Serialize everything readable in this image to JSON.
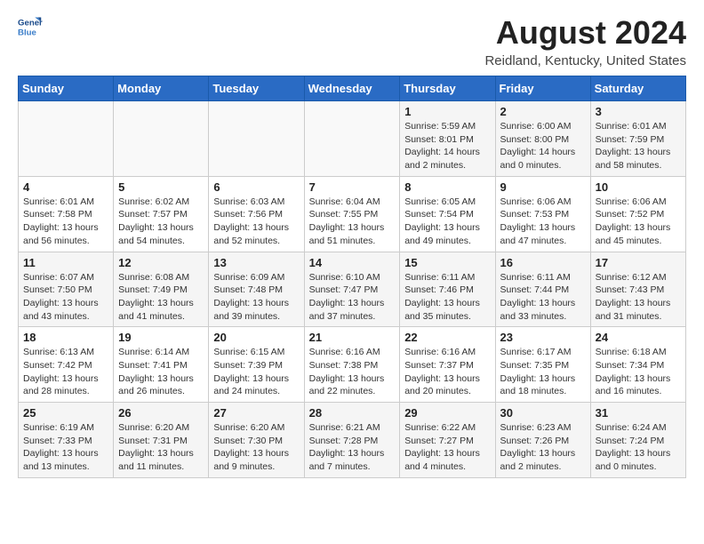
{
  "header": {
    "logo_line1": "General",
    "logo_line2": "Blue",
    "month_year": "August 2024",
    "location": "Reidland, Kentucky, United States"
  },
  "weekdays": [
    "Sunday",
    "Monday",
    "Tuesday",
    "Wednesday",
    "Thursday",
    "Friday",
    "Saturday"
  ],
  "weeks": [
    [
      {
        "day": "",
        "content": ""
      },
      {
        "day": "",
        "content": ""
      },
      {
        "day": "",
        "content": ""
      },
      {
        "day": "",
        "content": ""
      },
      {
        "day": "1",
        "content": "Sunrise: 5:59 AM\nSunset: 8:01 PM\nDaylight: 14 hours\nand 2 minutes."
      },
      {
        "day": "2",
        "content": "Sunrise: 6:00 AM\nSunset: 8:00 PM\nDaylight: 14 hours\nand 0 minutes."
      },
      {
        "day": "3",
        "content": "Sunrise: 6:01 AM\nSunset: 7:59 PM\nDaylight: 13 hours\nand 58 minutes."
      }
    ],
    [
      {
        "day": "4",
        "content": "Sunrise: 6:01 AM\nSunset: 7:58 PM\nDaylight: 13 hours\nand 56 minutes."
      },
      {
        "day": "5",
        "content": "Sunrise: 6:02 AM\nSunset: 7:57 PM\nDaylight: 13 hours\nand 54 minutes."
      },
      {
        "day": "6",
        "content": "Sunrise: 6:03 AM\nSunset: 7:56 PM\nDaylight: 13 hours\nand 52 minutes."
      },
      {
        "day": "7",
        "content": "Sunrise: 6:04 AM\nSunset: 7:55 PM\nDaylight: 13 hours\nand 51 minutes."
      },
      {
        "day": "8",
        "content": "Sunrise: 6:05 AM\nSunset: 7:54 PM\nDaylight: 13 hours\nand 49 minutes."
      },
      {
        "day": "9",
        "content": "Sunrise: 6:06 AM\nSunset: 7:53 PM\nDaylight: 13 hours\nand 47 minutes."
      },
      {
        "day": "10",
        "content": "Sunrise: 6:06 AM\nSunset: 7:52 PM\nDaylight: 13 hours\nand 45 minutes."
      }
    ],
    [
      {
        "day": "11",
        "content": "Sunrise: 6:07 AM\nSunset: 7:50 PM\nDaylight: 13 hours\nand 43 minutes."
      },
      {
        "day": "12",
        "content": "Sunrise: 6:08 AM\nSunset: 7:49 PM\nDaylight: 13 hours\nand 41 minutes."
      },
      {
        "day": "13",
        "content": "Sunrise: 6:09 AM\nSunset: 7:48 PM\nDaylight: 13 hours\nand 39 minutes."
      },
      {
        "day": "14",
        "content": "Sunrise: 6:10 AM\nSunset: 7:47 PM\nDaylight: 13 hours\nand 37 minutes."
      },
      {
        "day": "15",
        "content": "Sunrise: 6:11 AM\nSunset: 7:46 PM\nDaylight: 13 hours\nand 35 minutes."
      },
      {
        "day": "16",
        "content": "Sunrise: 6:11 AM\nSunset: 7:44 PM\nDaylight: 13 hours\nand 33 minutes."
      },
      {
        "day": "17",
        "content": "Sunrise: 6:12 AM\nSunset: 7:43 PM\nDaylight: 13 hours\nand 31 minutes."
      }
    ],
    [
      {
        "day": "18",
        "content": "Sunrise: 6:13 AM\nSunset: 7:42 PM\nDaylight: 13 hours\nand 28 minutes."
      },
      {
        "day": "19",
        "content": "Sunrise: 6:14 AM\nSunset: 7:41 PM\nDaylight: 13 hours\nand 26 minutes."
      },
      {
        "day": "20",
        "content": "Sunrise: 6:15 AM\nSunset: 7:39 PM\nDaylight: 13 hours\nand 24 minutes."
      },
      {
        "day": "21",
        "content": "Sunrise: 6:16 AM\nSunset: 7:38 PM\nDaylight: 13 hours\nand 22 minutes."
      },
      {
        "day": "22",
        "content": "Sunrise: 6:16 AM\nSunset: 7:37 PM\nDaylight: 13 hours\nand 20 minutes."
      },
      {
        "day": "23",
        "content": "Sunrise: 6:17 AM\nSunset: 7:35 PM\nDaylight: 13 hours\nand 18 minutes."
      },
      {
        "day": "24",
        "content": "Sunrise: 6:18 AM\nSunset: 7:34 PM\nDaylight: 13 hours\nand 16 minutes."
      }
    ],
    [
      {
        "day": "25",
        "content": "Sunrise: 6:19 AM\nSunset: 7:33 PM\nDaylight: 13 hours\nand 13 minutes."
      },
      {
        "day": "26",
        "content": "Sunrise: 6:20 AM\nSunset: 7:31 PM\nDaylight: 13 hours\nand 11 minutes."
      },
      {
        "day": "27",
        "content": "Sunrise: 6:20 AM\nSunset: 7:30 PM\nDaylight: 13 hours\nand 9 minutes."
      },
      {
        "day": "28",
        "content": "Sunrise: 6:21 AM\nSunset: 7:28 PM\nDaylight: 13 hours\nand 7 minutes."
      },
      {
        "day": "29",
        "content": "Sunrise: 6:22 AM\nSunset: 7:27 PM\nDaylight: 13 hours\nand 4 minutes."
      },
      {
        "day": "30",
        "content": "Sunrise: 6:23 AM\nSunset: 7:26 PM\nDaylight: 13 hours\nand 2 minutes."
      },
      {
        "day": "31",
        "content": "Sunrise: 6:24 AM\nSunset: 7:24 PM\nDaylight: 13 hours\nand 0 minutes."
      }
    ]
  ]
}
